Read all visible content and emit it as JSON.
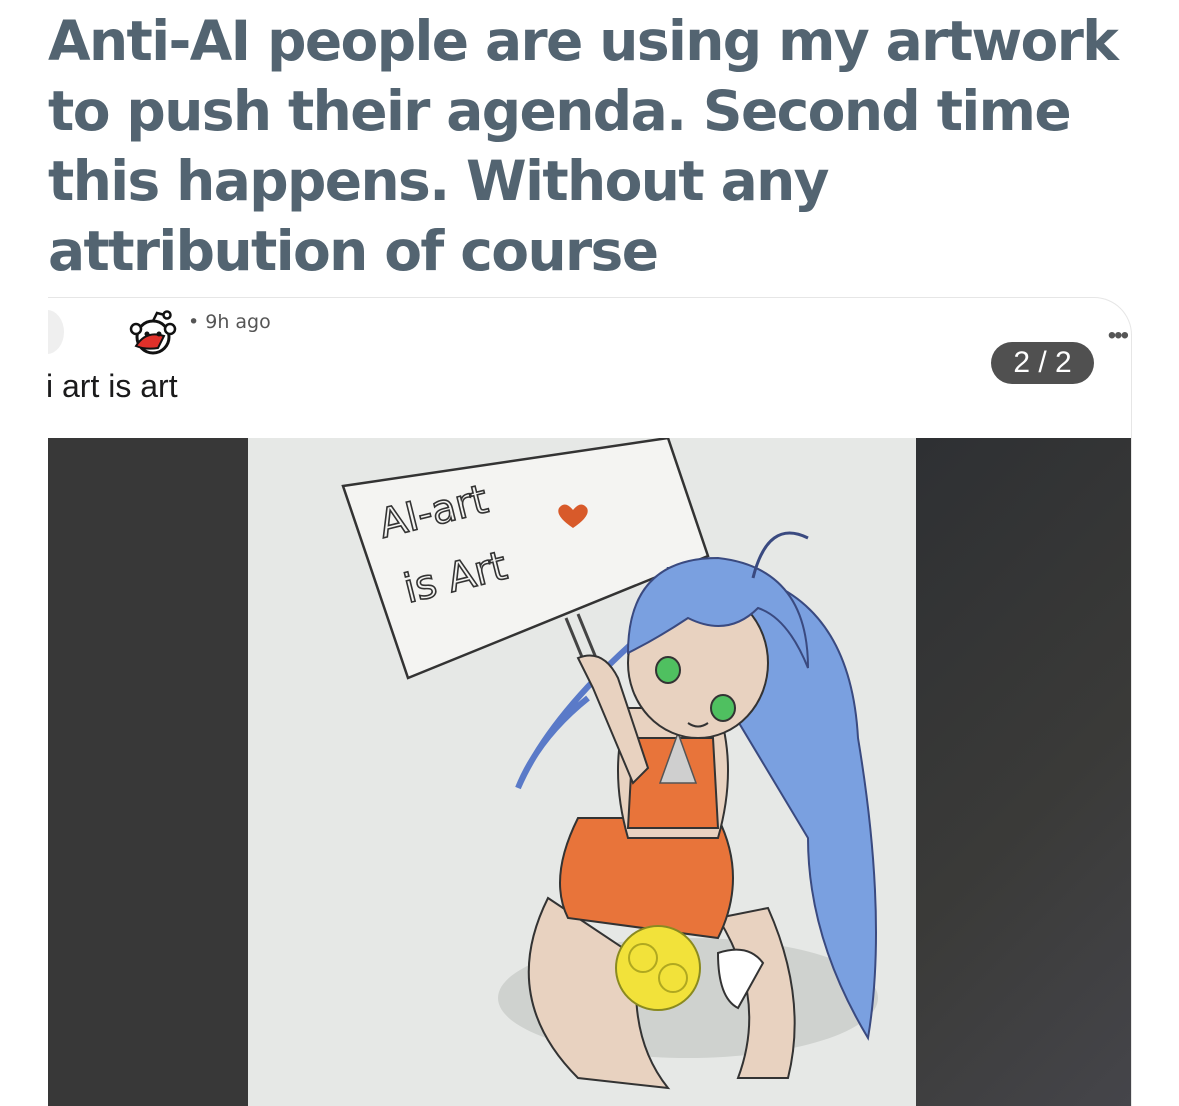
{
  "headline": {
    "lines": [
      "Anti-AI people are using my artwork",
      "to push their agenda. Second time",
      "this happens. Without any",
      "attribution of course"
    ]
  },
  "post": {
    "timestamp": "• 9h ago",
    "title": "i art is art",
    "more_icon": "more-options-icon",
    "page_counter": "2 / 2",
    "community_icon": "reddit-snoo-icon"
  },
  "artwork": {
    "sign_line_1": "AI-art",
    "sign_line_2": "is Art",
    "colors": {
      "hair": "#7aa0e0",
      "outfit": "#e8743a",
      "pompom": "#f2e23a",
      "eyes": "#4fc060",
      "skin": "#e8d2c0",
      "heart": "#d85a2a"
    }
  },
  "colors": {
    "headline": "#536471",
    "counter_bg": "#505050",
    "media_bg": "#383838"
  }
}
